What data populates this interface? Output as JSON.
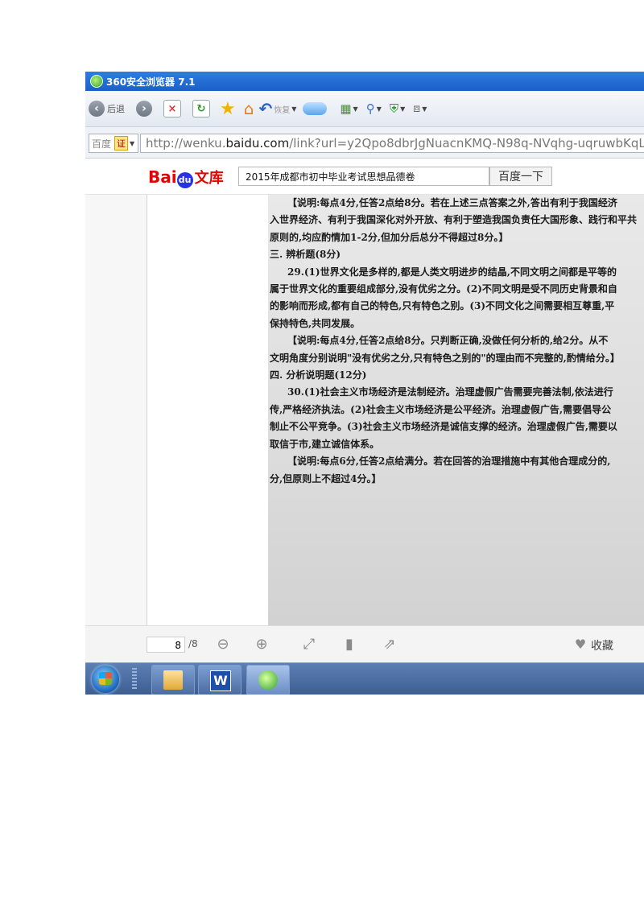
{
  "browser": {
    "title": "360安全浏览器 7.1",
    "back_label": "后退",
    "restore_label": "恢复",
    "address_prefix": "百度",
    "cert_label": "证",
    "url_pre": "http://wenku.",
    "url_host": "baidu.com",
    "url_post": "/link?url=y2Qpo8dbrJgNuacnKMQ-N98q-NVqhg-uqruwbKqL"
  },
  "baidu": {
    "logo_bai": "Bai",
    "logo_du": "du",
    "logo_wenku": "文库",
    "search_value": "2015年成都市初中毕业考试思想品德卷",
    "search_button": "百度一下"
  },
  "document": {
    "lines": [
      {
        "text": "【说明:每点4分,任答2点给8分。若在上述三点答案之外,答出有利于我国经济",
        "indent": true
      },
      {
        "text": "入世界经济、有利于我国深化对外开放、有利于塑造我国负责任大国形象、践行和平共",
        "indent": false
      },
      {
        "text": "原则的,均应酌情加1-2分,但加分后总分不得超过8分。】",
        "indent": false
      },
      {
        "text": "三. 辨析题(8分)",
        "indent": false
      },
      {
        "text": "29.(1)世界文化是多样的,都是人类文明进步的结晶,不同文明之间都是平等的",
        "indent": true
      },
      {
        "text": "属于世界文化的重要组成部分,没有优劣之分。(2)不同文明是受不同历史背景和自",
        "indent": false
      },
      {
        "text": "的影响而形成,都有自己的特色,只有特色之别。(3)不同文化之间需要相互尊重,平",
        "indent": false
      },
      {
        "text": "保持特色,共同发展。",
        "indent": false
      },
      {
        "text": "【说明:每点4分,任答2点给8分。只判断正确,没做任何分析的,给2分。从不",
        "indent": true
      },
      {
        "text": "文明角度分别说明\"没有优劣之分,只有特色之别的\"的理由而不完整的,酌情给分。】",
        "indent": false
      },
      {
        "text": "四. 分析说明题(12分)",
        "indent": false
      },
      {
        "text": "30.(1)社会主义市场经济是法制经济。治理虚假广告需要完善法制,依法进行",
        "indent": true
      },
      {
        "text": "传,严格经济执法。(2)社会主义市场经济是公平经济。治理虚假广告,需要倡导公",
        "indent": false
      },
      {
        "text": "制止不公平竞争。(3)社会主义市场经济是诚信支撑的经济。治理虚假广告,需要以",
        "indent": false
      },
      {
        "text": "取信于市,建立诚信体系。",
        "indent": false
      },
      {
        "text": "【说明:每点6分,任答2点给满分。若在回答的治理措施中有其他合理成分的,",
        "indent": true
      },
      {
        "text": "分,但原则上不超过4分。】",
        "indent": false
      }
    ]
  },
  "viewer": {
    "current_page": "8",
    "total_pages": "/8",
    "collect_label": "收藏"
  }
}
